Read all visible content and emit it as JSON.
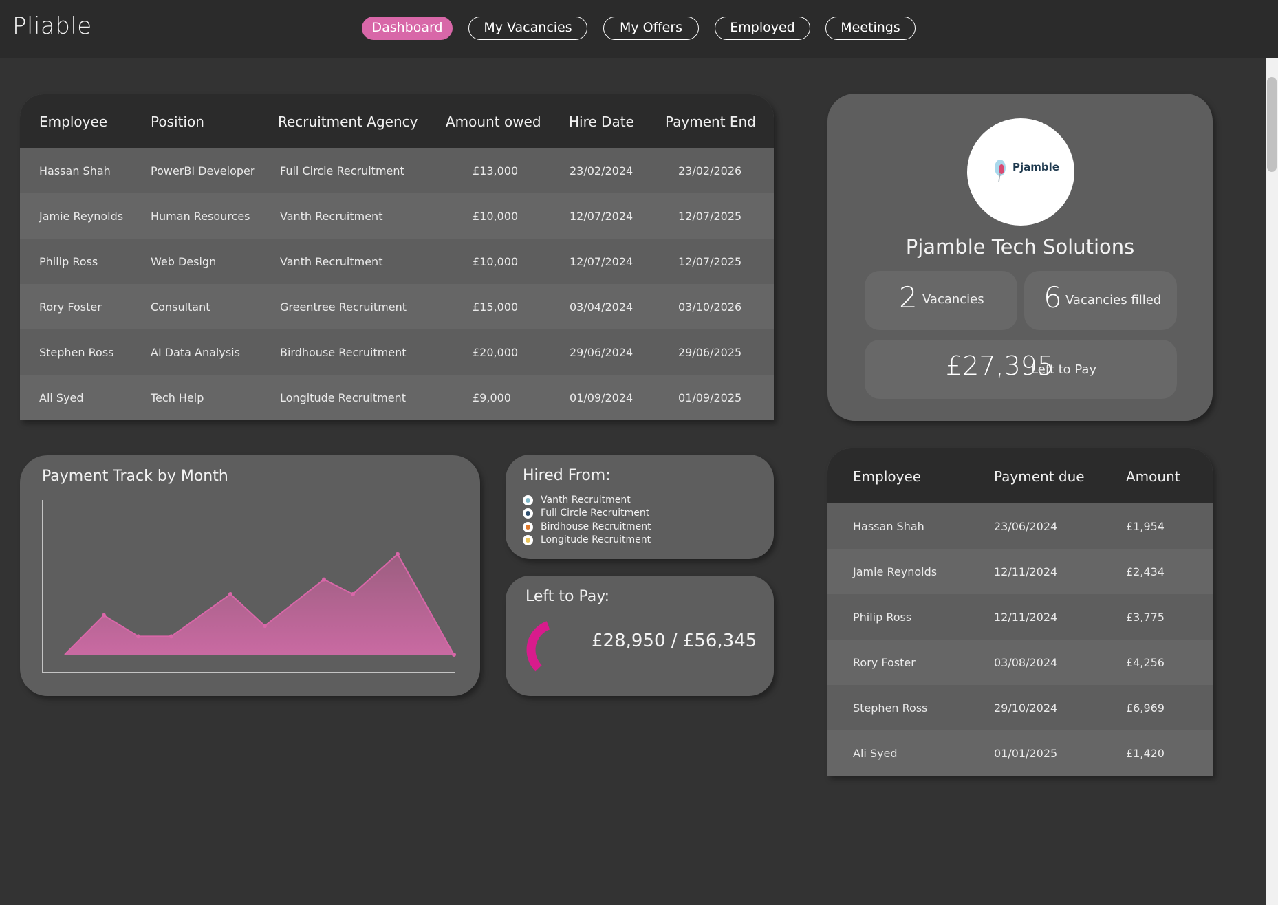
{
  "app": {
    "brand": "Pliable"
  },
  "nav": {
    "items": [
      {
        "label": "Dashboard",
        "active": true
      },
      {
        "label": "My Vacancies",
        "active": false
      },
      {
        "label": "My Offers",
        "active": false
      },
      {
        "label": "Employed",
        "active": false
      },
      {
        "label": "Meetings",
        "active": false
      }
    ]
  },
  "employees_table": {
    "headers": [
      "Employee",
      "Position",
      "Recruitment Agency",
      "Amount owed",
      "Hire Date",
      "Payment End"
    ],
    "rows": [
      [
        "Hassan Shah",
        "PowerBI Developer",
        "Full Circle Recruitment",
        "£13,000",
        "23/02/2024",
        "23/02/2026"
      ],
      [
        "Jamie Reynolds",
        "Human Resources",
        "Vanth Recruitment",
        "£10,000",
        "12/07/2024",
        "12/07/2025"
      ],
      [
        "Philip Ross",
        "Web Design",
        "Vanth Recruitment",
        "£10,000",
        "12/07/2024",
        "12/07/2025"
      ],
      [
        "Rory Foster",
        "Consultant",
        "Greentree Recruitment",
        "£15,000",
        "03/04/2024",
        "03/10/2026"
      ],
      [
        "Stephen Ross",
        "AI Data Analysis",
        "Birdhouse Recruitment",
        "£20,000",
        "29/06/2024",
        "29/06/2025"
      ],
      [
        "Ali Syed",
        "Tech Help",
        "Longitude Recruitment",
        "£9,000",
        "01/09/2024",
        "01/09/2025"
      ]
    ]
  },
  "company": {
    "logo_text": "Pjamble",
    "name": "Pjamble Tech Solutions",
    "vacancies": {
      "value": "2",
      "label": "Vacancies"
    },
    "filled": {
      "value": "6",
      "label": "Vacancies filled"
    },
    "left_to_pay": {
      "value": "£27,395",
      "label": "Left to Pay"
    }
  },
  "payment_chart": {
    "title": "Payment Track by Month",
    "accent": "#d867a8"
  },
  "chart_data": {
    "type": "area",
    "title": "Payment Track by Month",
    "xlabel": "",
    "ylabel": "",
    "x": [
      1,
      2,
      3,
      4,
      5,
      6,
      7,
      8,
      9,
      10
    ],
    "values": [
      0,
      56,
      26,
      26,
      86,
      41,
      107,
      86,
      143,
      0
    ],
    "ylim": [
      0,
      220
    ],
    "grid": false,
    "legend": "none",
    "color": "#d867a8"
  },
  "hired_from": {
    "title": "Hired From:",
    "items": [
      {
        "label": "Vanth Recruitment",
        "icon": "vanth-logo-icon",
        "color": "#7fb8c9"
      },
      {
        "label": "Full Circle Recruitment",
        "icon": "full-circle-logo-icon",
        "color": "#2f4f6f"
      },
      {
        "label": "Birdhouse Recruitment",
        "icon": "birdhouse-logo-icon",
        "color": "#e07a2e"
      },
      {
        "label": "Longitude Recruitment",
        "icon": "longitude-logo-icon",
        "color": "#e8c35a"
      }
    ]
  },
  "left_to_pay": {
    "title": "Left to Pay:",
    "paid_text": "£28,950 / £56,345",
    "progress": 0.514,
    "accent": "#d81b8c"
  },
  "payments_table": {
    "headers": [
      "Employee",
      "Payment due",
      "Amount"
    ],
    "rows": [
      [
        "Hassan Shah",
        "23/06/2024",
        "£1,954"
      ],
      [
        "Jamie Reynolds",
        "12/11/2024",
        "£2,434"
      ],
      [
        "Philip Ross",
        "12/11/2024",
        "£3,775"
      ],
      [
        "Rory Foster",
        "03/08/2024",
        "£4,256"
      ],
      [
        "Stephen Ross",
        "29/10/2024",
        "£6,969"
      ],
      [
        "Ali Syed",
        "01/01/2025",
        "£1,420"
      ]
    ]
  }
}
